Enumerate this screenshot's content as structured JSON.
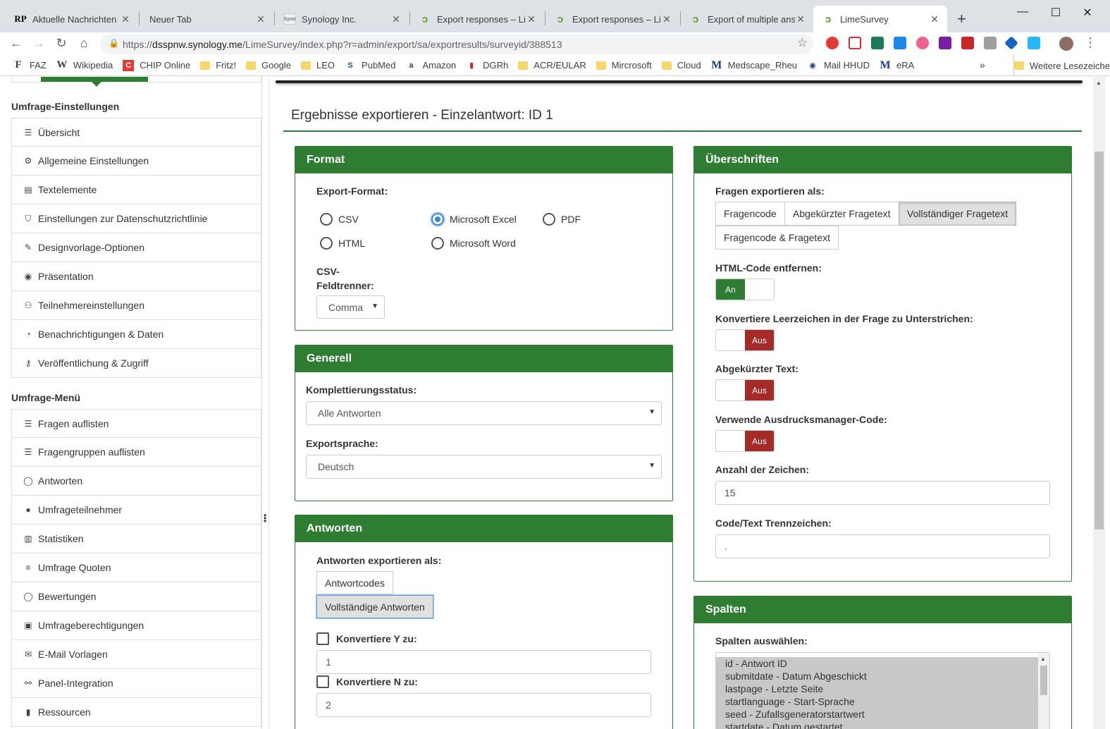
{
  "browser": {
    "tabs": [
      {
        "icon": "rp-icon",
        "title": "Aktuelle Nachrichten | R"
      },
      {
        "icon": "",
        "title": "Neuer Tab"
      },
      {
        "icon": "synology-icon",
        "title": "Synology Inc."
      },
      {
        "icon": "limesurvey-icon",
        "title": "Export responses – Lime"
      },
      {
        "icon": "limesurvey-icon",
        "title": "Export responses – Lime"
      },
      {
        "icon": "limesurvey-icon",
        "title": "Export of multiple answ"
      },
      {
        "icon": "limesurvey-icon",
        "title": "LimeSurvey"
      }
    ],
    "active_tab": 6,
    "url": {
      "scheme": "https://",
      "host": "dsspnw.synology.me",
      "path": "/LimeSurvey/index.php?r=admin/export/sa/exportresults/surveyid/388513"
    },
    "bookmarks": [
      {
        "icon": "faz-icon",
        "label": "FAZ"
      },
      {
        "icon": "wikipedia-icon",
        "label": "Wikipedia"
      },
      {
        "icon": "chip-icon",
        "label": "CHIP Online"
      },
      {
        "icon": "folder-icon",
        "label": "Fritz!"
      },
      {
        "icon": "folder-icon",
        "label": "Google"
      },
      {
        "icon": "folder-icon",
        "label": "LEO"
      },
      {
        "icon": "pubmed-icon",
        "label": "PubMed"
      },
      {
        "icon": "amazon-icon",
        "label": "Amazon"
      },
      {
        "icon": "dgrh-icon",
        "label": "DGRh"
      },
      {
        "icon": "folder-icon",
        "label": "ACR/EULAR"
      },
      {
        "icon": "folder-icon",
        "label": "Mircrosoft"
      },
      {
        "icon": "folder-icon",
        "label": "Cloud"
      },
      {
        "icon": "medscape-icon",
        "label": "Medscape_Rheu"
      },
      {
        "icon": "mail-icon",
        "label": "Mail HHUD"
      },
      {
        "icon": "era-icon",
        "label": "eRA"
      }
    ],
    "more_bookmarks": "»",
    "other_bookmarks": "Weitere Lesezeichen",
    "new_tab": "+",
    "window": {
      "minimize": "—",
      "maximize": "☐",
      "close": "✕"
    }
  },
  "sidebar": {
    "settings_heading": "Umfrage-Einstellungen",
    "settings_items": [
      {
        "icon": "list-icon",
        "glyph": "☰",
        "label": "Übersicht"
      },
      {
        "icon": "gears-icon",
        "glyph": "⚙",
        "label": "Allgemeine Einstellungen"
      },
      {
        "icon": "file-text-icon",
        "glyph": "▤",
        "label": "Textelemente"
      },
      {
        "icon": "shield-icon",
        "glyph": "⛉",
        "label": "Einstellungen zur Datenschutzrichtlinie"
      },
      {
        "icon": "paintbrush-icon",
        "glyph": "✎",
        "label": "Designvorlage-Optionen"
      },
      {
        "icon": "eye-slash-icon",
        "glyph": "◉",
        "label": "Präsentation"
      },
      {
        "icon": "users-icon",
        "glyph": "👥",
        "label": "Teilnehmereinstellungen"
      },
      {
        "icon": "rss-icon",
        "glyph": "◔",
        "label": "Benachrichtigungen & Daten"
      },
      {
        "icon": "key-icon",
        "glyph": "⚷",
        "label": "Veröffentlichung & Zugriff"
      }
    ],
    "menu_heading": "Umfrage-Menü",
    "menu_items": [
      {
        "icon": "list-icon",
        "glyph": "☰",
        "label": "Fragen auflisten"
      },
      {
        "icon": "list-icon",
        "glyph": "☰",
        "label": "Fragengruppen auflisten"
      },
      {
        "icon": "comment-icon",
        "glyph": "💬",
        "label": "Antworten"
      },
      {
        "icon": "user-icon",
        "glyph": "👤",
        "label": "Umfrageteilnehmer"
      },
      {
        "icon": "bar-chart-icon",
        "glyph": "▥",
        "label": "Statistiken"
      },
      {
        "icon": "tasks-icon",
        "glyph": "≡",
        "label": "Umfrage Quoten"
      },
      {
        "icon": "comment-icon",
        "glyph": "💬",
        "label": "Bewertungen"
      },
      {
        "icon": "lock-icon",
        "glyph": "🔒",
        "label": "Umfrageberechtigungen"
      },
      {
        "icon": "envelope-icon",
        "glyph": "✉",
        "label": "E-Mail Vorlagen"
      },
      {
        "icon": "link-icon",
        "glyph": "⚯",
        "label": "Panel-Integration"
      },
      {
        "icon": "file-icon",
        "glyph": "▮",
        "label": "Ressourcen"
      }
    ]
  },
  "main": {
    "title": "Ergebnisse exportieren - Einzelantwort: ID 1",
    "format": {
      "heading": "Format",
      "export_format_label": "Export-Format:",
      "options": [
        "CSV",
        "Microsoft Excel",
        "PDF",
        "HTML",
        "Microsoft Word"
      ],
      "selected": "Microsoft Excel",
      "csv_sep_label_1": "CSV-",
      "csv_sep_label_2": "Feldtrenner:",
      "csv_sep_value": "Comma"
    },
    "general": {
      "heading": "Generell",
      "completion_label": "Komplettierungsstatus:",
      "completion_value": "Alle Antworten",
      "language_label": "Exportsprache:",
      "language_value": "Deutsch"
    },
    "answers": {
      "heading": "Antworten",
      "export_as_label": "Antworten exportieren als:",
      "options": [
        "Antwortcodes",
        "Vollständige Antworten"
      ],
      "selected": "Vollständige Antworten",
      "convert_y_label": "Konvertiere Y zu:",
      "convert_y_value": "1",
      "convert_n_label": "Konvertiere N zu:",
      "convert_n_value": "2"
    },
    "headings": {
      "heading": "Überschriften",
      "export_questions_label": "Fragen exportieren als:",
      "options": [
        "Fragencode",
        "Abgekürzter Fragetext",
        "Vollständiger Fragetext",
        "Fragencode & Fragetext"
      ],
      "selected": "Vollständiger Fragetext",
      "strip_html_label": "HTML-Code entfernen:",
      "strip_html_value": "An",
      "convert_spaces_label": "Konvertiere Leerzeichen in der Frage zu Unterstrichen:",
      "convert_spaces_value": "Aus",
      "abbrev_label": "Abgekürzter Text:",
      "abbrev_value": "Aus",
      "em_code_label": "Verwende Ausdrucksmanager-Code:",
      "em_code_value": "Aus",
      "chars_label": "Anzahl der Zeichen:",
      "chars_value": "15",
      "separator_label": "Code/Text Trennzeichen:",
      "separator_value": "."
    },
    "columns": {
      "heading": "Spalten",
      "select_label": "Spalten auswählen:",
      "items": [
        "id - Antwort ID",
        "submitdate - Datum Abgeschickt",
        "lastpage - Letzte Seite",
        "startlanguage - Start-Sprache",
        "seed - Zufallsgeneratorstartwert",
        "startdate - Datum gestartet"
      ]
    }
  },
  "colors": {
    "accent": "#2e7d32",
    "off_switch": "#a52a2a",
    "radio_selected": "#3a87d6"
  }
}
